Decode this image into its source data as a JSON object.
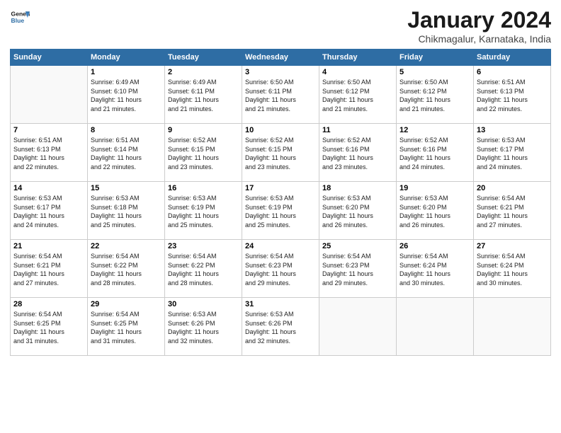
{
  "logo": {
    "line1": "General",
    "line2": "Blue"
  },
  "header": {
    "title": "January 2024",
    "subtitle": "Chikmagalur, Karnataka, India"
  },
  "weekdays": [
    "Sunday",
    "Monday",
    "Tuesday",
    "Wednesday",
    "Thursday",
    "Friday",
    "Saturday"
  ],
  "weeks": [
    [
      {
        "num": "",
        "info": ""
      },
      {
        "num": "1",
        "info": "Sunrise: 6:49 AM\nSunset: 6:10 PM\nDaylight: 11 hours\nand 21 minutes."
      },
      {
        "num": "2",
        "info": "Sunrise: 6:49 AM\nSunset: 6:11 PM\nDaylight: 11 hours\nand 21 minutes."
      },
      {
        "num": "3",
        "info": "Sunrise: 6:50 AM\nSunset: 6:11 PM\nDaylight: 11 hours\nand 21 minutes."
      },
      {
        "num": "4",
        "info": "Sunrise: 6:50 AM\nSunset: 6:12 PM\nDaylight: 11 hours\nand 21 minutes."
      },
      {
        "num": "5",
        "info": "Sunrise: 6:50 AM\nSunset: 6:12 PM\nDaylight: 11 hours\nand 21 minutes."
      },
      {
        "num": "6",
        "info": "Sunrise: 6:51 AM\nSunset: 6:13 PM\nDaylight: 11 hours\nand 22 minutes."
      }
    ],
    [
      {
        "num": "7",
        "info": "Sunrise: 6:51 AM\nSunset: 6:13 PM\nDaylight: 11 hours\nand 22 minutes."
      },
      {
        "num": "8",
        "info": "Sunrise: 6:51 AM\nSunset: 6:14 PM\nDaylight: 11 hours\nand 22 minutes."
      },
      {
        "num": "9",
        "info": "Sunrise: 6:52 AM\nSunset: 6:15 PM\nDaylight: 11 hours\nand 23 minutes."
      },
      {
        "num": "10",
        "info": "Sunrise: 6:52 AM\nSunset: 6:15 PM\nDaylight: 11 hours\nand 23 minutes."
      },
      {
        "num": "11",
        "info": "Sunrise: 6:52 AM\nSunset: 6:16 PM\nDaylight: 11 hours\nand 23 minutes."
      },
      {
        "num": "12",
        "info": "Sunrise: 6:52 AM\nSunset: 6:16 PM\nDaylight: 11 hours\nand 24 minutes."
      },
      {
        "num": "13",
        "info": "Sunrise: 6:53 AM\nSunset: 6:17 PM\nDaylight: 11 hours\nand 24 minutes."
      }
    ],
    [
      {
        "num": "14",
        "info": "Sunrise: 6:53 AM\nSunset: 6:17 PM\nDaylight: 11 hours\nand 24 minutes."
      },
      {
        "num": "15",
        "info": "Sunrise: 6:53 AM\nSunset: 6:18 PM\nDaylight: 11 hours\nand 25 minutes."
      },
      {
        "num": "16",
        "info": "Sunrise: 6:53 AM\nSunset: 6:19 PM\nDaylight: 11 hours\nand 25 minutes."
      },
      {
        "num": "17",
        "info": "Sunrise: 6:53 AM\nSunset: 6:19 PM\nDaylight: 11 hours\nand 25 minutes."
      },
      {
        "num": "18",
        "info": "Sunrise: 6:53 AM\nSunset: 6:20 PM\nDaylight: 11 hours\nand 26 minutes."
      },
      {
        "num": "19",
        "info": "Sunrise: 6:53 AM\nSunset: 6:20 PM\nDaylight: 11 hours\nand 26 minutes."
      },
      {
        "num": "20",
        "info": "Sunrise: 6:54 AM\nSunset: 6:21 PM\nDaylight: 11 hours\nand 27 minutes."
      }
    ],
    [
      {
        "num": "21",
        "info": "Sunrise: 6:54 AM\nSunset: 6:21 PM\nDaylight: 11 hours\nand 27 minutes."
      },
      {
        "num": "22",
        "info": "Sunrise: 6:54 AM\nSunset: 6:22 PM\nDaylight: 11 hours\nand 28 minutes."
      },
      {
        "num": "23",
        "info": "Sunrise: 6:54 AM\nSunset: 6:22 PM\nDaylight: 11 hours\nand 28 minutes."
      },
      {
        "num": "24",
        "info": "Sunrise: 6:54 AM\nSunset: 6:23 PM\nDaylight: 11 hours\nand 29 minutes."
      },
      {
        "num": "25",
        "info": "Sunrise: 6:54 AM\nSunset: 6:23 PM\nDaylight: 11 hours\nand 29 minutes."
      },
      {
        "num": "26",
        "info": "Sunrise: 6:54 AM\nSunset: 6:24 PM\nDaylight: 11 hours\nand 30 minutes."
      },
      {
        "num": "27",
        "info": "Sunrise: 6:54 AM\nSunset: 6:24 PM\nDaylight: 11 hours\nand 30 minutes."
      }
    ],
    [
      {
        "num": "28",
        "info": "Sunrise: 6:54 AM\nSunset: 6:25 PM\nDaylight: 11 hours\nand 31 minutes."
      },
      {
        "num": "29",
        "info": "Sunrise: 6:54 AM\nSunset: 6:25 PM\nDaylight: 11 hours\nand 31 minutes."
      },
      {
        "num": "30",
        "info": "Sunrise: 6:53 AM\nSunset: 6:26 PM\nDaylight: 11 hours\nand 32 minutes."
      },
      {
        "num": "31",
        "info": "Sunrise: 6:53 AM\nSunset: 6:26 PM\nDaylight: 11 hours\nand 32 minutes."
      },
      {
        "num": "",
        "info": ""
      },
      {
        "num": "",
        "info": ""
      },
      {
        "num": "",
        "info": ""
      }
    ]
  ]
}
